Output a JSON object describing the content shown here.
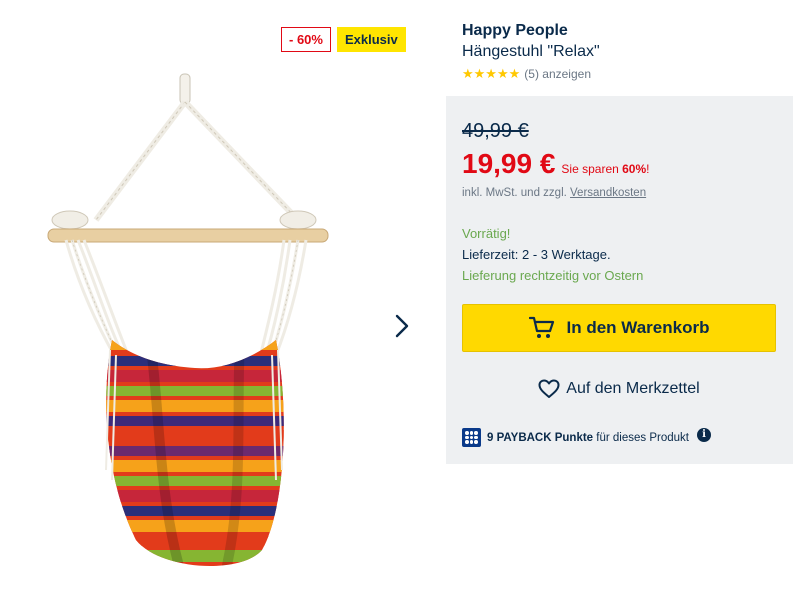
{
  "badges": {
    "discount": "- 60%",
    "exclusive": "Exklusiv"
  },
  "product": {
    "brand": "Happy People",
    "name": "Hängestuhl \"Relax\"",
    "rating_stars": "★★★★★",
    "rating_value": 5,
    "rating_link": "(5) anzeigen"
  },
  "price": {
    "old": "49,99 €",
    "new": "19,99 €",
    "savings_prefix": "Sie sparen ",
    "savings_percent": "60%",
    "savings_suffix": "!",
    "tax_prefix": "inkl. MwSt. und zzgl. ",
    "shipping_link": "Versandkosten"
  },
  "availability": {
    "stock": "Vorrätig!",
    "delivery": "Lieferzeit: 2 - 3 Werktage.",
    "easter": "Lieferung rechtzeitig vor Ostern"
  },
  "actions": {
    "cart": "In den Warenkorb",
    "wishlist": "Auf den Merkzettel"
  },
  "payback": {
    "points": "9 PAYBACK Punkte",
    "suffix": " für dieses Produkt",
    "info": "i"
  },
  "gallery": {
    "next_icon": "chevron-right-icon"
  },
  "colors": {
    "accent_yellow": "#ffd900",
    "price_red": "#e10915",
    "navy": "#0a2a4a",
    "stock_green": "#6aa84f",
    "panel_gray": "#eef0f2"
  }
}
